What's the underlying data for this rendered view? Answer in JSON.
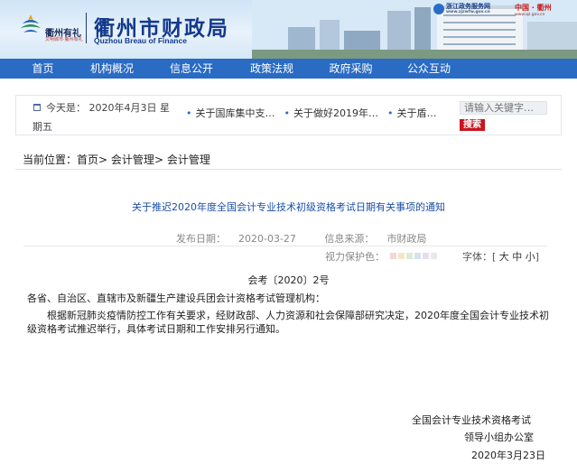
{
  "header": {
    "logo_text": "衢州有礼",
    "logo_sub": "文明城市·衢州有礼",
    "site_title": "衢州市财政局",
    "site_subtitle": "Quzhou Breau of Finance",
    "gov_service_label": "浙江政务服务网",
    "gov_service_url": "www.zjzwfw.gov.cn",
    "city_portal_label": "中国 · 衢州",
    "city_portal_url": "www.qz.gov.cn"
  },
  "nav": {
    "items": [
      "首页",
      "机构概况",
      "信息公开",
      "政策法规",
      "政府采购",
      "公众互动"
    ]
  },
  "infobar": {
    "date_line1": "今天是： 2020年4月3日 星",
    "date_line2": "期五",
    "ticker": [
      "关于国库集中支…",
      "关于做好2019年…",
      "关于盾…"
    ],
    "search_placeholder": "请输入关键字…",
    "search_button": "搜索"
  },
  "breadcrumb": {
    "prefix": "当前位置：",
    "items": [
      "首页",
      "会计管理",
      "会计管理"
    ],
    "separator": ">"
  },
  "article": {
    "title": "关于推迟2020年度全国会计专业技术初级资格考试日期有关事项的通知",
    "publish_label": "发布日期：",
    "publish_date": "2020-03-27",
    "source_label": "信息来源：",
    "source": "市财政局",
    "vision_label": "视力保护色：",
    "vision_colors": [
      "#f5d5d5",
      "#f3e6c8",
      "#d9ecd4",
      "#d4e3ef",
      "#e6ddef",
      "#e8e8e8"
    ],
    "font_label": "字体：",
    "font_big": "大",
    "font_mid": "中",
    "font_small": "小",
    "doc_number": "会考〔2020〕2号",
    "addressee": "各省、自治区、直辖市及新疆生产建设兵团会计资格考试管理机构：",
    "body": "根据新冠肺炎疫情防控工作有关要求，经财政部、人力资源和社会保障部研究决定，2020年度全国会计专业技术初级资格考试推迟举行，具体考试日期和工作安排另行通知。",
    "signature_line1": "全国会计专业技术资格考试",
    "signature_line2": "领导小组办公室",
    "signature_date": "2020年3月23日"
  },
  "colors": {
    "nav_bg": "#2a6bc4",
    "title_blue": "#143a8c",
    "search_button": "#c9151e",
    "article_title": "#1b4fa8"
  }
}
